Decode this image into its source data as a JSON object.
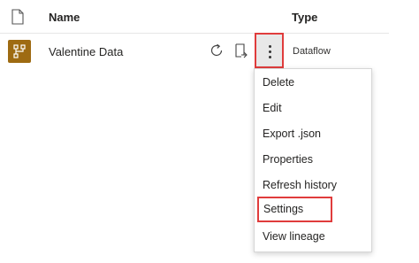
{
  "table": {
    "columns": {
      "name": "Name",
      "type": "Type"
    },
    "rows": [
      {
        "name": "Valentine Data",
        "type": "Dataflow"
      }
    ]
  },
  "row_actions": {
    "refresh_icon": "refresh-icon",
    "schedule_icon": "schedule-icon",
    "more_icon": "more-options-icon"
  },
  "menu": {
    "items": [
      {
        "label": "Delete"
      },
      {
        "label": "Edit"
      },
      {
        "label": "Export .json"
      },
      {
        "label": "Properties"
      },
      {
        "label": "Refresh history"
      },
      {
        "label": "Settings",
        "highlighted": true
      },
      {
        "label": "View lineage"
      }
    ]
  },
  "colors": {
    "accent_highlight": "#e03c3c",
    "dataflow_icon": "#9e6b12"
  }
}
